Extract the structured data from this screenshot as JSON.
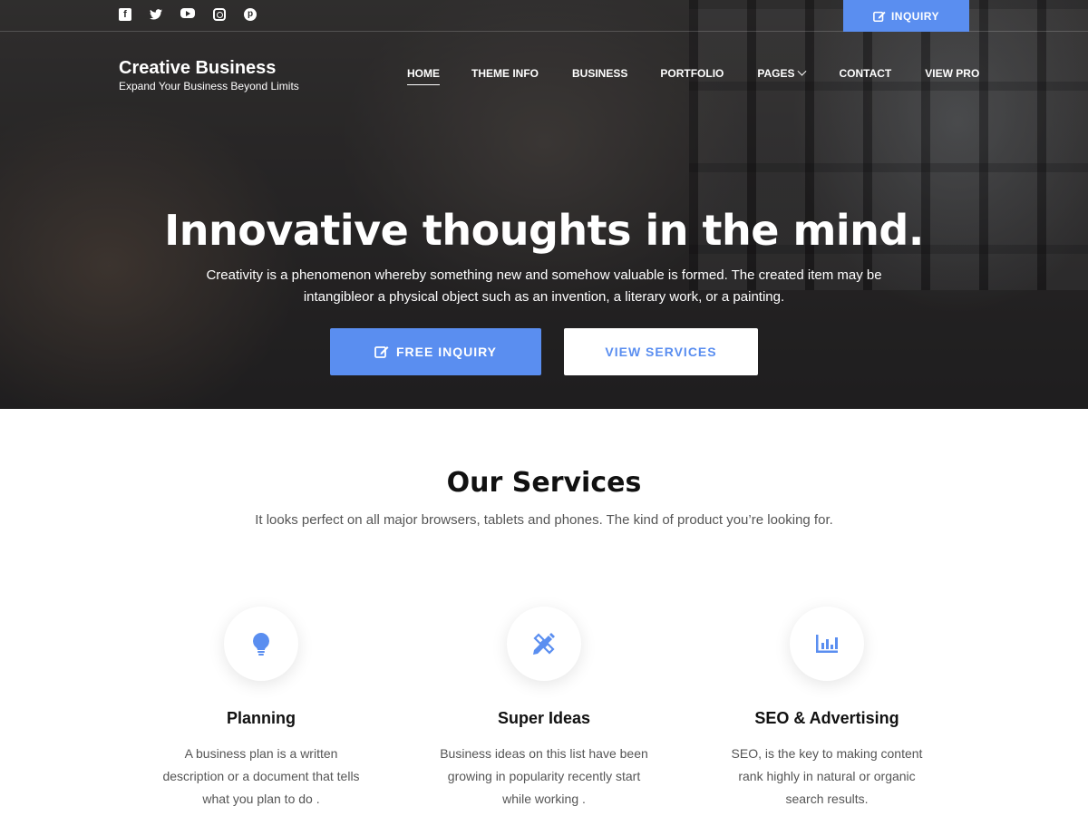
{
  "topbar": {
    "social": [
      "facebook-icon",
      "twitter-icon",
      "youtube-icon",
      "instagram-icon",
      "pinterest-icon"
    ],
    "inquiry_label": "INQUIRY"
  },
  "brand": {
    "title": "Creative Business",
    "tagline": "Expand Your Business Beyond Limits"
  },
  "nav": {
    "items": [
      {
        "label": "HOME",
        "active": true
      },
      {
        "label": "THEME INFO"
      },
      {
        "label": "BUSINESS"
      },
      {
        "label": "PORTFOLIO"
      },
      {
        "label": "PAGES",
        "dropdown": true
      },
      {
        "label": "CONTACT"
      },
      {
        "label": "VIEW PRO"
      }
    ]
  },
  "hero": {
    "title": "Innovative thoughts in the mind.",
    "description": "Creativity is a phenomenon whereby something new and somehow valuable is formed. The created item may be intangibleor a physical object such as an invention, a literary work, or a painting.",
    "primary_button": "FREE INQUIRY",
    "secondary_button": "VIEW SERVICES"
  },
  "services": {
    "title": "Our Services",
    "subtitle": "It looks perfect on all major browsers, tablets and phones. The kind of product you’re looking for.",
    "cards": [
      {
        "icon": "lightbulb-icon",
        "title": "Planning",
        "text": "A business plan is a written description or a document that tells what you plan to do ."
      },
      {
        "icon": "pencil-ruler-icon",
        "title": "Super Ideas",
        "text": "Business ideas on this list have been growing in popularity recently start while working ."
      },
      {
        "icon": "bar-chart-icon",
        "title": "SEO & Advertising",
        "text": "SEO, is the key to making content rank highly in natural or organic search results."
      }
    ]
  },
  "colors": {
    "accent": "#5a8ef0",
    "text_dark": "#111111",
    "text_muted": "#555555"
  }
}
